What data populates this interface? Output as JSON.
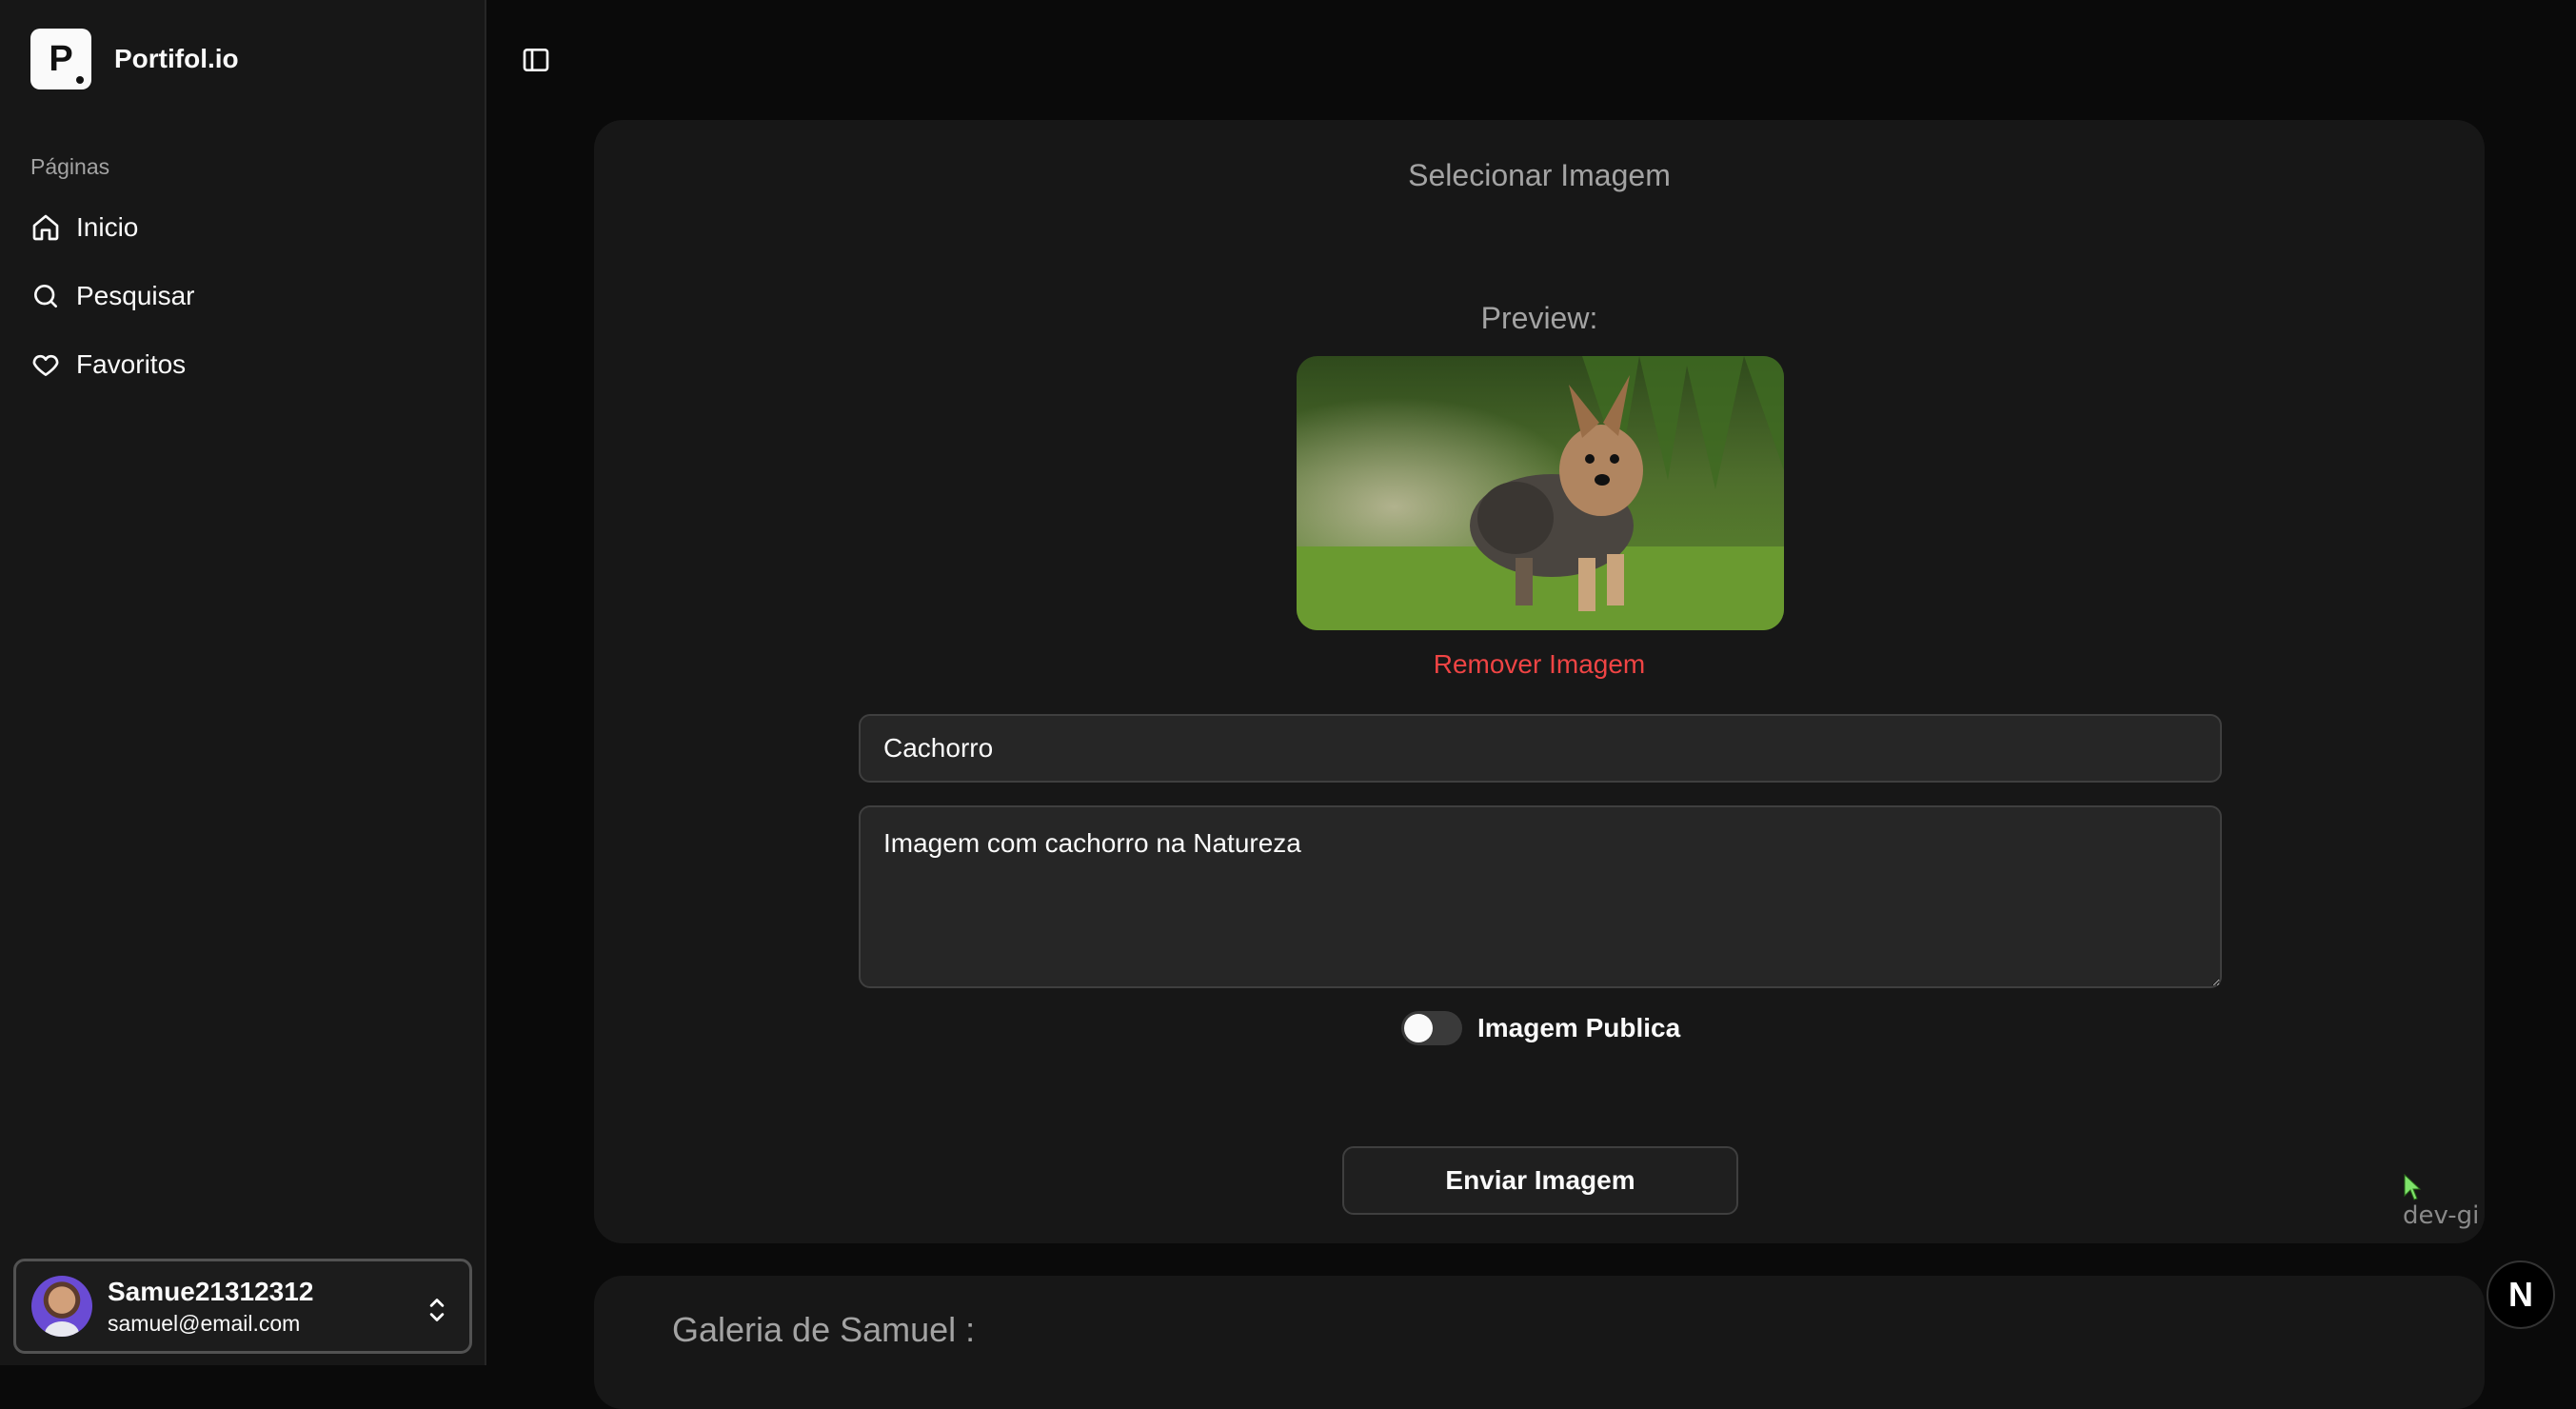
{
  "brand": {
    "logo_letter": "P",
    "name": "Portifol.io"
  },
  "sidebar": {
    "section_label": "Páginas",
    "items": [
      {
        "label": "Inicio",
        "icon": "home-icon"
      },
      {
        "label": "Pesquisar",
        "icon": "search-icon"
      },
      {
        "label": "Favoritos",
        "icon": "heart-icon"
      }
    ]
  },
  "user": {
    "name": "Samue21312312",
    "email": "samuel@email.com"
  },
  "upload": {
    "title": "Selecionar Imagem",
    "preview_label": "Preview:",
    "remove_label": "Remover Imagem",
    "title_value": "Cachorro",
    "description_value": "Imagem com cachorro na Natureza",
    "public_label": "Imagem Publica",
    "public_enabled": false,
    "submit_label": "Enviar Imagem"
  },
  "gallery": {
    "title": "Galeria de Samuel :"
  },
  "overlay": {
    "watermark": "dev-gi",
    "next_badge": "N"
  },
  "colors": {
    "accent_danger": "#ef4444",
    "background": "#0a0a0a",
    "card": "#171717"
  }
}
